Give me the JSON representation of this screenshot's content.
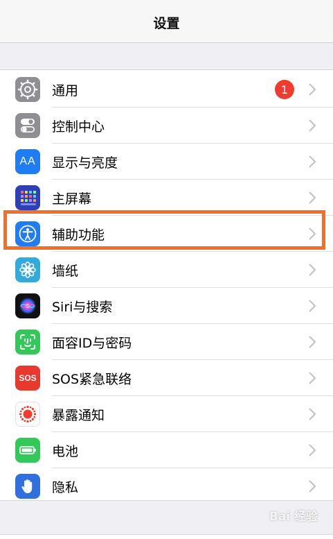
{
  "header": {
    "title": "设置"
  },
  "badge": {
    "general_count": "1"
  },
  "settings": {
    "items": [
      {
        "label": "通用",
        "icon": "gear-icon",
        "color": "#8e8e93"
      },
      {
        "label": "控制中心",
        "icon": "toggle-switches-icon",
        "color": "#8e8e93"
      },
      {
        "label": "显示与亮度",
        "icon": "text-size-icon",
        "color": "#1f7cf3"
      },
      {
        "label": "主屏幕",
        "icon": "home-grid-icon",
        "color": "#2e3fb8"
      },
      {
        "label": "辅助功能",
        "icon": "accessibility-person-icon",
        "color": "#1f7cf3"
      },
      {
        "label": "墙纸",
        "icon": "flower-icon",
        "color": "#33aadc"
      },
      {
        "label": "Siri与搜索",
        "icon": "siri-icon",
        "color": "#111111"
      },
      {
        "label": "面容ID与密码",
        "icon": "face-id-icon",
        "color": "#34c759"
      },
      {
        "label": "SOS紧急联络",
        "icon": "sos-icon",
        "color": "#e8392f"
      },
      {
        "label": "暴露通知",
        "icon": "exposure-notification-icon",
        "color": "#ffffff"
      },
      {
        "label": "电池",
        "icon": "battery-icon",
        "color": "#34c759"
      },
      {
        "label": "隐私",
        "icon": "hand-icon",
        "color": "#2f6fe0"
      }
    ]
  },
  "sos_icon_text": "SOS",
  "text_size_icon_text": "AA",
  "highlight_color": "#f06f2a",
  "watermark": "Bai 经验"
}
